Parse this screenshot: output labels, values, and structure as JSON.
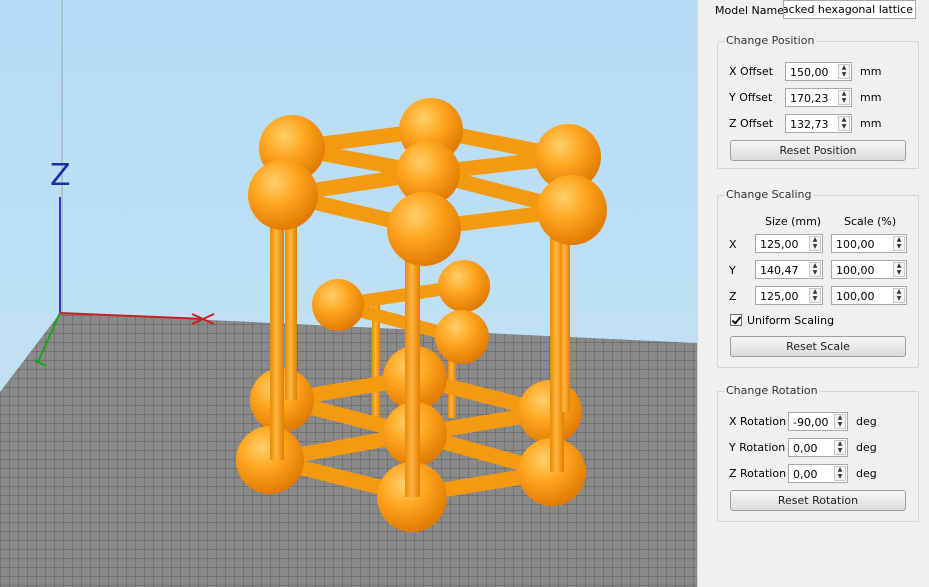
{
  "viewport": {
    "axis_z_label": "Z",
    "colors": {
      "sphere": "#ffa21d",
      "bed_grid": "#6b6b6b",
      "sky": "#bfe0f5"
    }
  },
  "panel": {
    "model_name_label": "Model Name:",
    "model_name_value": "e-packed hexagonal lattice",
    "position": {
      "title": "Change Position",
      "rows": [
        {
          "label": "X Offset",
          "value": "150,00",
          "unit": "mm"
        },
        {
          "label": "Y Offset",
          "value": "170,23",
          "unit": "mm"
        },
        {
          "label": "Z Offset",
          "value": "132,73",
          "unit": "mm"
        }
      ],
      "reset_label": "Reset Position"
    },
    "scaling": {
      "title": "Change Scaling",
      "size_header": "Size (mm)",
      "scale_header": "Scale (%)",
      "rows": [
        {
          "axis": "X",
          "size": "125,00",
          "scale": "100,00"
        },
        {
          "axis": "Y",
          "size": "140,47",
          "scale": "100,00"
        },
        {
          "axis": "Z",
          "size": "125,00",
          "scale": "100,00"
        }
      ],
      "uniform_label": "Uniform Scaling",
      "uniform_checked": true,
      "reset_label": "Reset Scale"
    },
    "rotation": {
      "title": "Change Rotation",
      "rows": [
        {
          "label": "X Rotation",
          "value": "-90,00",
          "unit": "deg"
        },
        {
          "label": "Y Rotation",
          "value": "0,00",
          "unit": "deg"
        },
        {
          "label": "Z Rotation",
          "value": "0,00",
          "unit": "deg"
        }
      ],
      "reset_label": "Reset Rotation"
    }
  }
}
